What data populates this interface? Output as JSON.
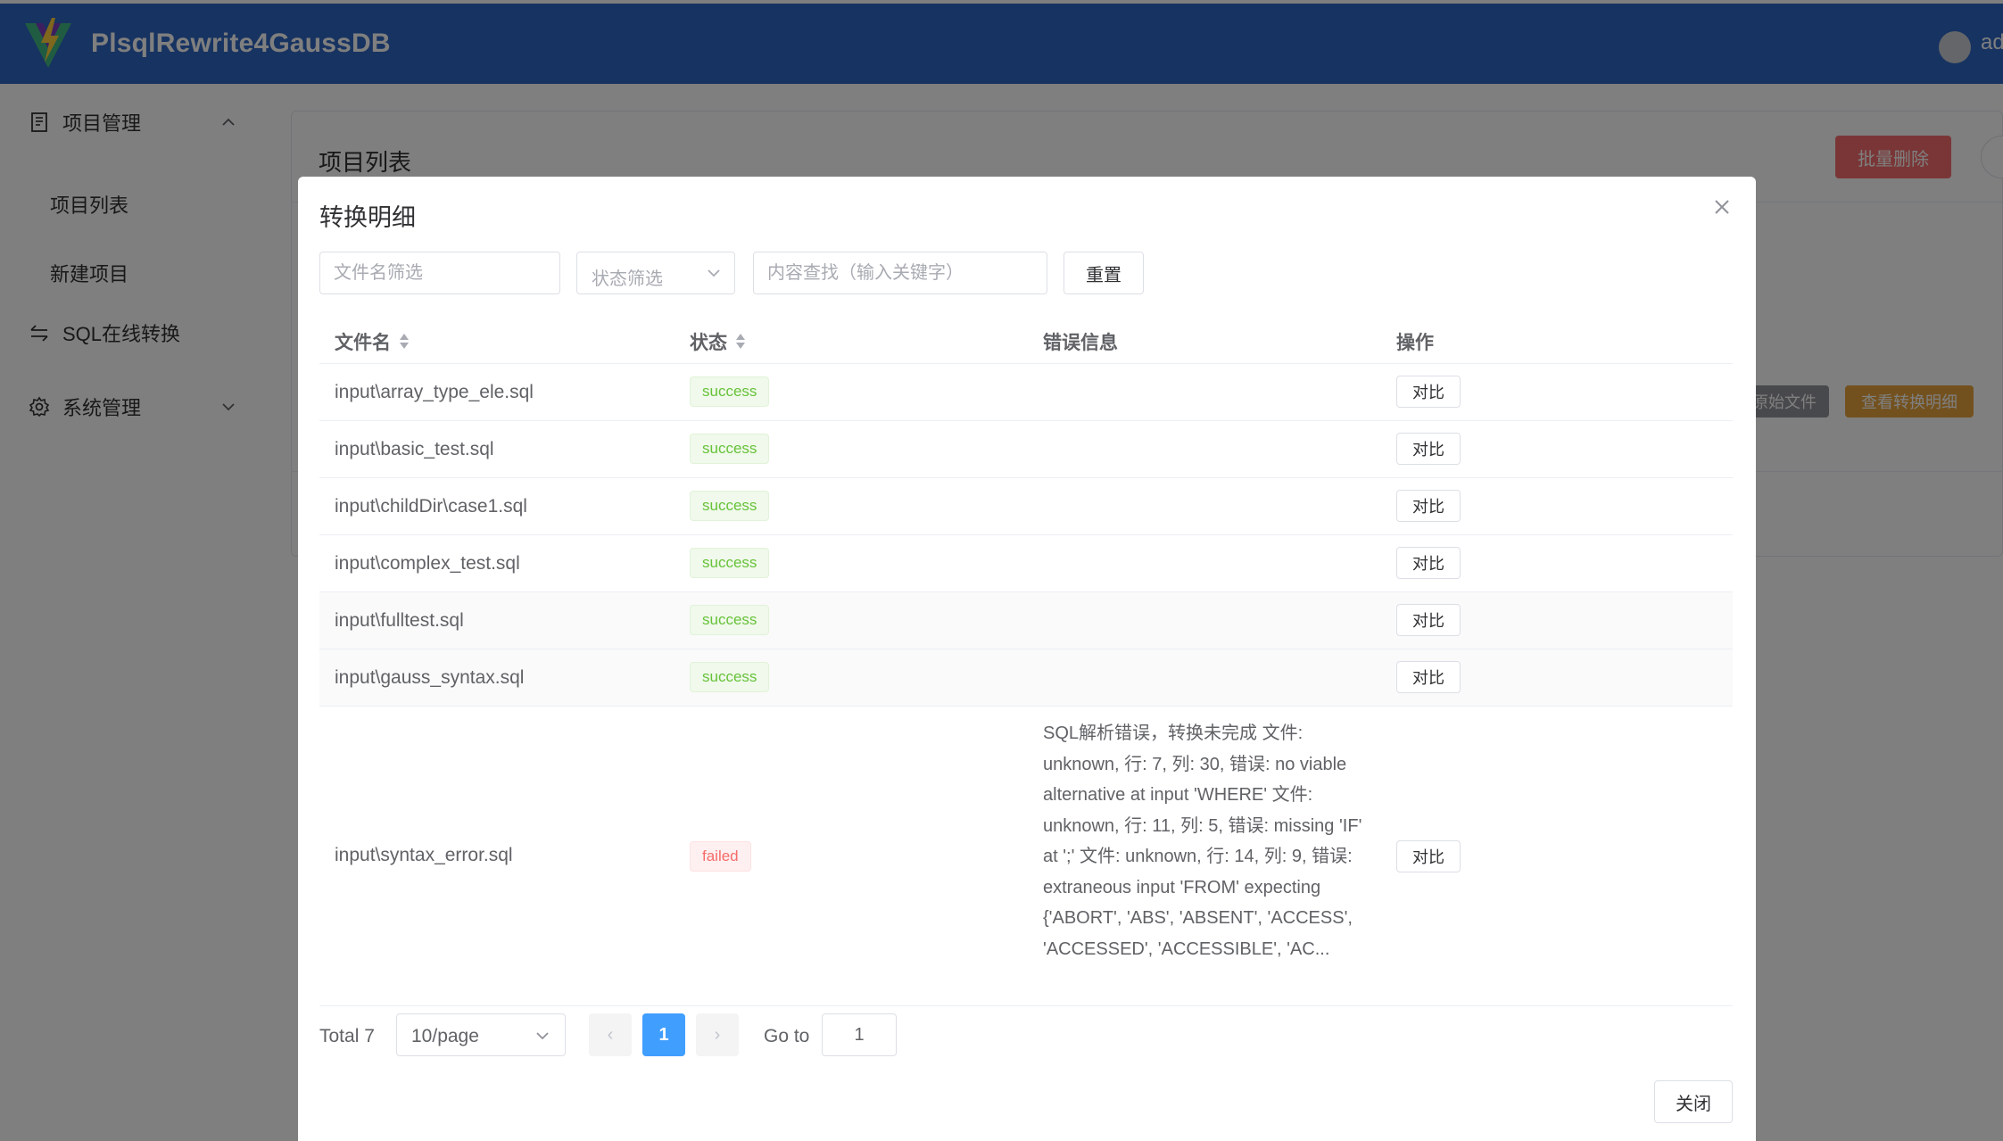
{
  "header": {
    "app_title": "PlsqlRewrite4GaussDB",
    "user_name": "ad"
  },
  "sidebar": {
    "project_mgmt": "项目管理",
    "project_list": "项目列表",
    "new_project": "新建项目",
    "sql_online": "SQL在线转换",
    "system_mgmt": "系统管理"
  },
  "page": {
    "card_title": "项目列表",
    "batch_delete": "批量删除",
    "view_original": "原始文件",
    "view_detail": "查看转换明细"
  },
  "modal": {
    "title": "转换明细",
    "filename_placeholder": "文件名筛选",
    "status_placeholder": "状态筛选",
    "content_placeholder": "内容查找（输入关键字）",
    "reset_label": "重置",
    "close_label": "关闭",
    "columns": {
      "filename": "文件名",
      "status": "状态",
      "error": "错误信息",
      "action": "操作"
    },
    "rows": [
      {
        "file": "input\\array_type_ele.sql",
        "status": "success",
        "error": "",
        "action": "对比"
      },
      {
        "file": "input\\basic_test.sql",
        "status": "success",
        "error": "",
        "action": "对比"
      },
      {
        "file": "input\\childDir\\case1.sql",
        "status": "success",
        "error": "",
        "action": "对比"
      },
      {
        "file": "input\\complex_test.sql",
        "status": "success",
        "error": "",
        "action": "对比"
      },
      {
        "file": "input\\fulltest.sql",
        "status": "success",
        "error": "",
        "action": "对比"
      },
      {
        "file": "input\\gauss_syntax.sql",
        "status": "success",
        "error": "",
        "action": "对比"
      },
      {
        "file": "input\\syntax_error.sql",
        "status": "failed",
        "error": "SQL解析错误，转换未完成 文件: unknown, 行: 7, 列: 30, 错误: no viable alternative at input 'WHERE' 文件: unknown, 行: 11, 列: 5, 错误: missing 'IF' at ';' 文件: unknown, 行: 14, 列: 9, 错误: extraneous input 'FROM' expecting {'ABORT', 'ABS', 'ABSENT', 'ACCESS', 'ACCESSED', 'ACCESSIBLE', 'AC...",
        "action": "对比"
      }
    ],
    "pagination": {
      "total_label": "Total 7",
      "page_size": "10/page",
      "current_page": "1",
      "prev_icon": "‹",
      "next_icon": "›",
      "goto_label": "Go to",
      "goto_value": "1"
    }
  },
  "colors": {
    "header_bg": "#2f66c2",
    "primary": "#409eff",
    "success": "#67c23a",
    "danger": "#f56c6c",
    "warning": "#e6a23c"
  }
}
